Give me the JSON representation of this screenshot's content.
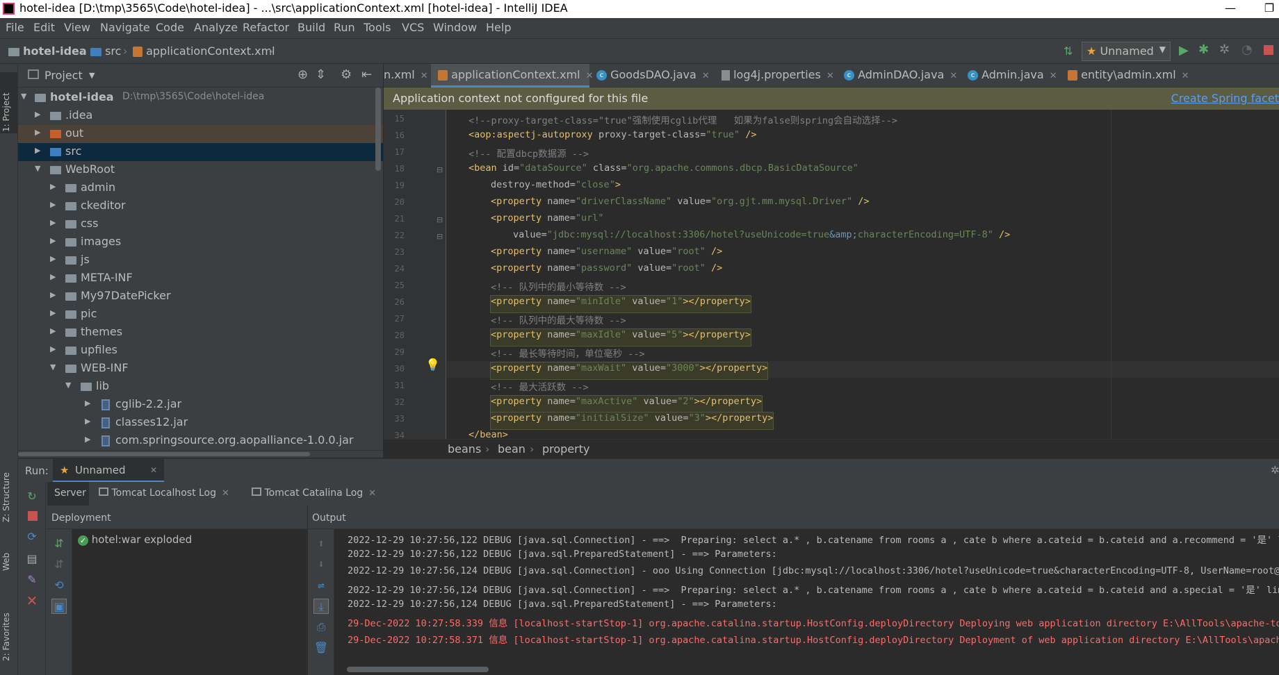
{
  "window": {
    "title": "hotel-idea [D:\\tmp\\3565\\Code\\hotel-idea] - ...\\src\\applicationContext.xml [hotel-idea] - IntelliJ IDEA",
    "minimize": "—",
    "maximize": "❐"
  },
  "menu": [
    "File",
    "Edit",
    "View",
    "Navigate",
    "Code",
    "Analyze",
    "Refactor",
    "Build",
    "Run",
    "Tools",
    "VCS",
    "Window",
    "Help"
  ],
  "breadcrumbs": [
    "hotel-idea",
    "src",
    "applicationContext.xml"
  ],
  "toolbar": {
    "run_config": "Unnamed"
  },
  "stripe": {
    "project": "1: Project",
    "structure": "Z: Structure",
    "web": "Web",
    "favorites": "2: Favorites"
  },
  "project_panel": {
    "title": "Project",
    "root_name": "hotel-idea",
    "root_path": "D:\\tmp\\3565\\Code\\hotel-idea",
    "items": [
      ".idea",
      "out",
      "src",
      "WebRoot",
      "admin",
      "ckeditor",
      "css",
      "images",
      "js",
      "META-INF",
      "My97DatePicker",
      "pic",
      "themes",
      "upfiles",
      "WEB-INF",
      "lib",
      "cglib-2.2.jar",
      "classes12.jar",
      "com.springsource.org.aopalliance-1.0.0.jar"
    ]
  },
  "tabs": [
    "n.xml",
    "applicationContext.xml",
    "GoodsDAO.java",
    "log4j.properties",
    "AdminDAO.java",
    "Admin.java",
    "entity\\admin.xml"
  ],
  "banner": {
    "message": "Application context not configured for this file",
    "action": "Create Spring facet"
  },
  "line_numbers": [
    "15",
    "16",
    "17",
    "18",
    "19",
    "20",
    "21",
    "22",
    "23",
    "24",
    "25",
    "26",
    "27",
    "28",
    "29",
    "30",
    "31",
    "32",
    "33",
    "34"
  ],
  "code": {
    "l15": "<!--proxy-target-class=\"true\"强制使用cglib代理   如果为false则spring会自动选择-->",
    "l16a": "<aop:aspectj-autoproxy ",
    "l16b": "proxy-target-class=",
    "l16c": "\"true\"",
    "l16d": " />",
    "l17": "<!-- 配置dbcp数据源 -->",
    "l18a": "<bean ",
    "l18b": "id=",
    "l18c": "\"dataSource\"",
    "l18d": " class=",
    "l18e": "\"org.apache.commons.dbcp.BasicDataSource\"",
    "l19a": "destroy-method=",
    "l19b": "\"close\"",
    "l19c": ">",
    "l20a": "<property ",
    "l20b": "name=",
    "l20c": "\"driverClassName\"",
    "l20d": " value=",
    "l20e": "\"org.gjt.mm.mysql.Driver\"",
    "l20f": " />",
    "l21a": "<property ",
    "l21b": "name=",
    "l21c": "\"url\"",
    "l22a": "value=",
    "l22b": "\"jdbc:mysql://localhost:3306/hotel?useUnicode=true",
    "l22c": "&amp;",
    "l22d": "characterEncoding=UTF-8\"",
    "l22e": " />",
    "l23a": "<property ",
    "l23b": "name=",
    "l23c": "\"username\"",
    "l23d": " value=",
    "l23e": "\"root\"",
    "l23f": " />",
    "l24a": "<property ",
    "l24b": "name=",
    "l24c": "\"password\"",
    "l24d": " value=",
    "l24e": "\"root\"",
    "l24f": " />",
    "l25": "<!-- 队列中的最小等待数 -->",
    "l26a": "<property ",
    "l26b": "name=",
    "l26c": "\"minIdle\"",
    "l26d": " value=",
    "l26e": "\"1\"",
    "l26f": "></property>",
    "l27": "<!-- 队列中的最大等待数 -->",
    "l28a": "<property ",
    "l28b": "name=",
    "l28c": "\"maxIdle\"",
    "l28d": " value=",
    "l28e": "\"5\"",
    "l28f": "></property>",
    "l29": "<!-- 最长等待时间，单位毫秒 -->",
    "l30a": "<property ",
    "l30b": "name=",
    "l30c": "\"maxWait\"",
    "l30d": " value=",
    "l30e": "\"3000\"",
    "l30f": "></property>",
    "l31": "<!-- 最大活跃数 -->",
    "l32a": "<property ",
    "l32b": "name=",
    "l32c": "\"maxActive\"",
    "l32d": " value=",
    "l32e": "\"2\"",
    "l32f": "></property>",
    "l33a": "<property ",
    "l33b": "name=",
    "l33c": "\"initialSize\"",
    "l33d": " value=",
    "l33e": "\"3\"",
    "l33f": "></property>",
    "l34": "</bean>"
  },
  "editor_crumbs": [
    "beans",
    "bean",
    "property"
  ],
  "run": {
    "label": "Run:",
    "config": "Unnamed",
    "subtabs": [
      "Server",
      "Tomcat Localhost Log",
      "Tomcat Catalina Log"
    ],
    "deployment_header": "Deployment",
    "output_header": "Output",
    "artifact": "hotel:war exploded",
    "log": [
      "2022-12-29 10:27:56,122 DEBUG [java.sql.Connection] - ==>  Preparing: select a.* , b.catename from rooms a , cate b where a.cateid = b.cateid and a.recommend = '是' limit",
      "2022-12-29 10:27:56,122 DEBUG [java.sql.PreparedStatement] - ==> Parameters: ",
      "2022-12-29 10:27:56,124 DEBUG [java.sql.Connection] - ooo Using Connection [jdbc:mysql://localhost:3306/hotel?useUnicode=true&characterEncoding=UTF-8, UserName=root@loca",
      "2022-12-29 10:27:56,124 DEBUG [java.sql.Connection] - ==>  Preparing: select a.* , b.catename from rooms a , cate b where a.cateid = b.cateid and a.special = '是' limit",
      "2022-12-29 10:27:56,124 DEBUG [java.sql.PreparedStatement] - ==> Parameters: ",
      "29-Dec-2022 10:27:58.339 信息 [localhost-startStop-1] org.apache.catalina.startup.HostConfig.deployDirectory Deploying web application directory E:\\AllTools\\apache-tomca",
      "29-Dec-2022 10:27:58.371 信息 [localhost-startStop-1] org.apache.catalina.startup.HostConfig.deployDirectory Deployment of web application directory E:\\AllTools\\apache-t"
    ]
  },
  "colors": {
    "accent": "#4a88c7",
    "background": "#2b2b2b",
    "panel": "#3c3f41",
    "error_log": "#ff6b68"
  }
}
